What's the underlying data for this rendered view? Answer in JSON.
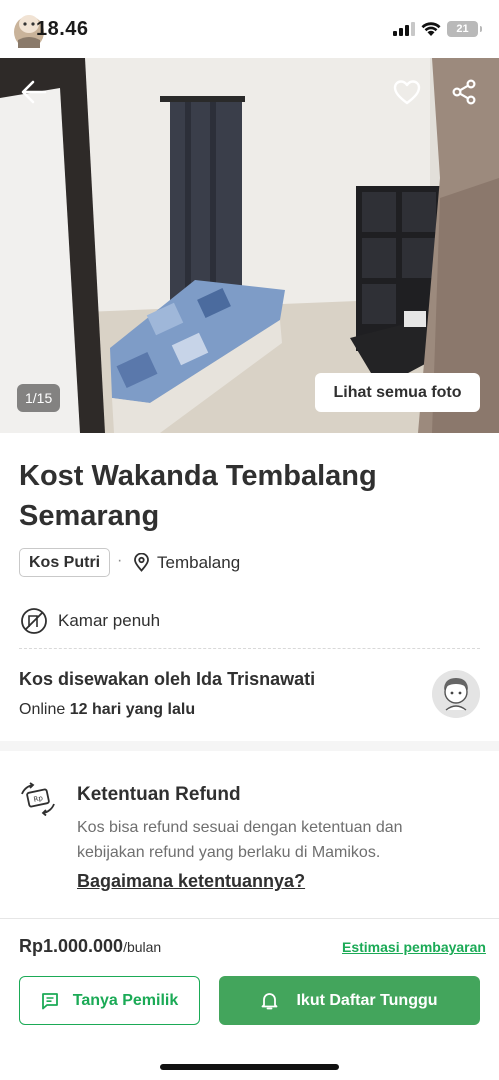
{
  "status_bar": {
    "time": "18.46",
    "battery": "21"
  },
  "gallery": {
    "counter": "1/15",
    "see_all_label": "Lihat semua foto"
  },
  "listing": {
    "title": "Kost Wakanda Tembalang Semarang",
    "type_badge": "Kos Putri",
    "separator": "·",
    "location": "Tembalang",
    "room_status": "Kamar penuh"
  },
  "owner": {
    "title": "Kos disewakan oleh Ida Trisnawati",
    "online_prefix": "Online",
    "online_time": "12 hari yang lalu"
  },
  "refund": {
    "title": "Ketentuan Refund",
    "description": "Kos bisa refund sesuai dengan ketentuan dan kebijakan refund yang berlaku di Mamikos.",
    "link": "Bagaimana ketentuannya?"
  },
  "bottom_bar": {
    "price": "Rp1.000.000",
    "price_unit": "/bulan",
    "estimate_link": "Estimasi pembayaran",
    "ask_owner_label": "Tanya Pemilik",
    "waitlist_label": "Ikut Daftar Tunggu"
  },
  "colors": {
    "brand_green": "#1baa56",
    "button_green": "#43a55c",
    "text_dark": "#303030",
    "text_muted": "#6f6f6f"
  },
  "icons": {
    "back": "back-arrow-icon",
    "favorite": "heart-icon",
    "share": "share-icon",
    "location": "location-pin-icon",
    "room_status": "room-full-icon",
    "refund": "money-refund-icon",
    "chat": "chat-icon",
    "bell": "bell-icon"
  }
}
